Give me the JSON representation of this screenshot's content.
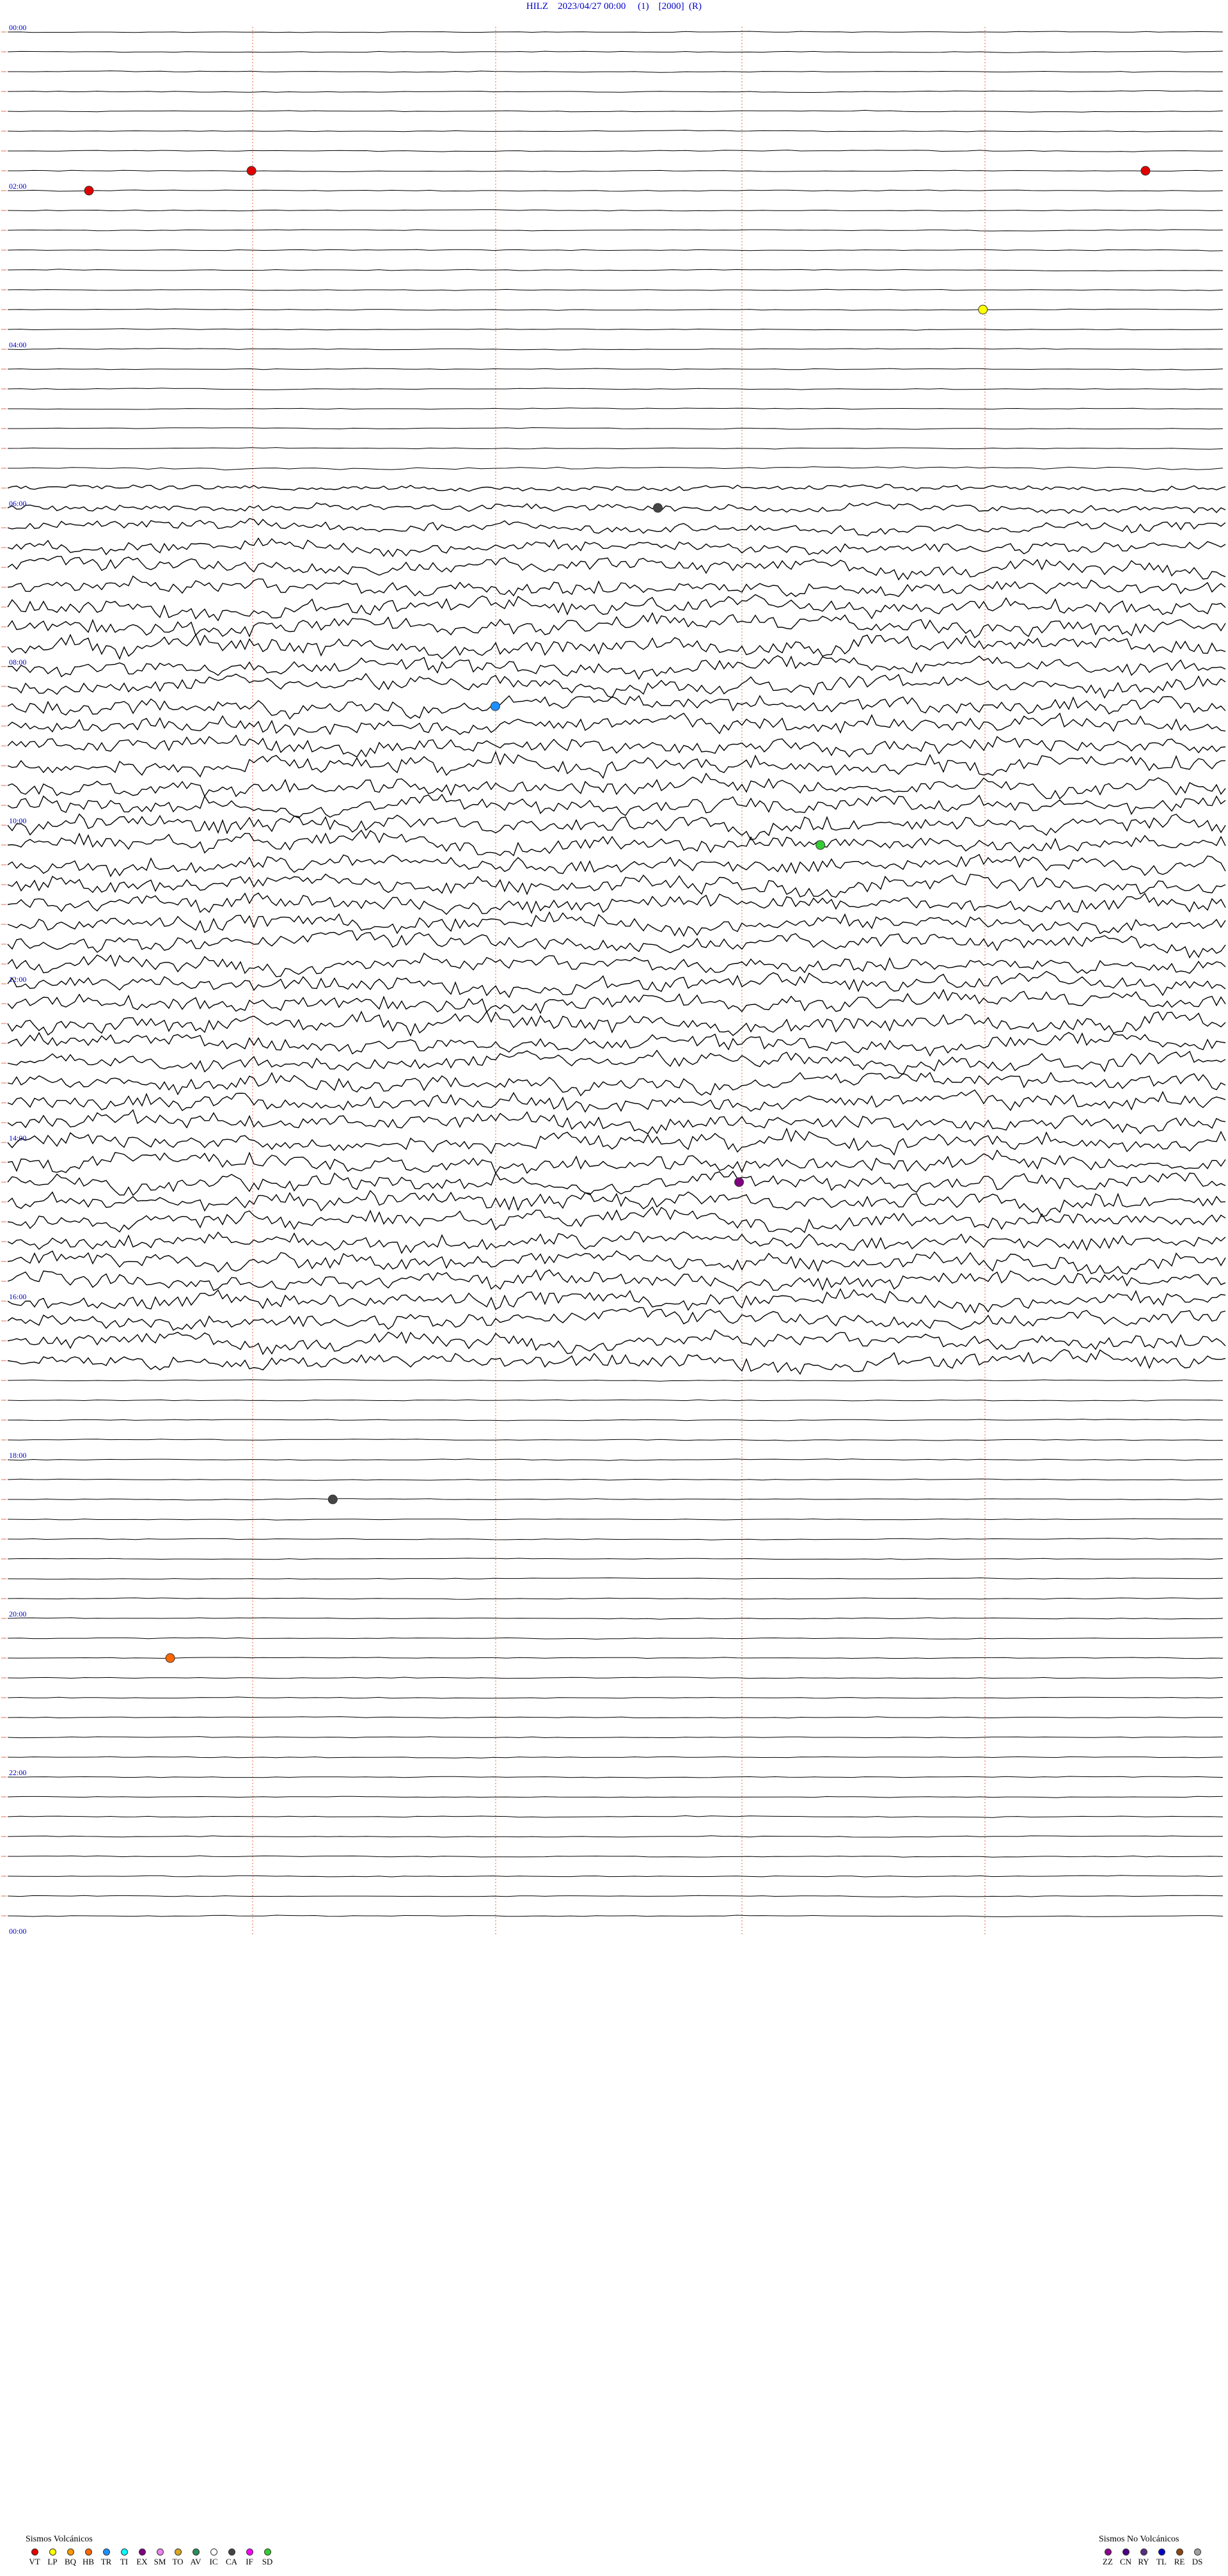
{
  "header": {
    "title": "HILZ    2023/04/27 00:00     (1)    [2000]  (R)"
  },
  "chart_data": {
    "type": "helicorder",
    "station": "HILZ",
    "date": "2023/04/27",
    "start_time": "00:00",
    "hour_labels": [
      "00:00",
      "02:00",
      "04:00",
      "06:00",
      "08:00",
      "10:00",
      "12:00",
      "14:00",
      "16:00",
      "18:00",
      "20:00",
      "22:00",
      "00:00"
    ],
    "rows": 96,
    "minutes_per_row": 15,
    "activity_profile": [
      {
        "from_row": 0,
        "to_row": 21,
        "noise": "low"
      },
      {
        "from_row": 22,
        "to_row": 27,
        "noise": "rising"
      },
      {
        "from_row": 28,
        "to_row": 67,
        "noise": "high"
      },
      {
        "from_row": 68,
        "to_row": 95,
        "noise": "low"
      }
    ],
    "events": [
      {
        "row": 7,
        "minute": 3,
        "type": "VT"
      },
      {
        "row": 7,
        "minute": 14,
        "type": "VT"
      },
      {
        "row": 8,
        "minute": 1,
        "type": "VT"
      },
      {
        "row": 14,
        "minute": 12,
        "type": "LP"
      },
      {
        "row": 24,
        "minute": 8,
        "type": "CA"
      },
      {
        "row": 34,
        "minute": 6,
        "type": "TR"
      },
      {
        "row": 41,
        "minute": 10,
        "type": "SD"
      },
      {
        "row": 58,
        "minute": 9,
        "type": "EX"
      },
      {
        "row": 74,
        "minute": 4,
        "type": "CA"
      },
      {
        "row": 82,
        "minute": 2,
        "type": "HB"
      }
    ],
    "legend": {
      "volcanic_title": "Sismos Volcánicos",
      "volcanic": [
        {
          "code": "VT",
          "color": "#e00000"
        },
        {
          "code": "LP",
          "color": "#ffff00"
        },
        {
          "code": "BQ",
          "color": "#ff9900"
        },
        {
          "code": "HB",
          "color": "#ff6600"
        },
        {
          "code": "TR",
          "color": "#1e90ff"
        },
        {
          "code": "TI",
          "color": "#00ffff"
        },
        {
          "code": "EX",
          "color": "#800080"
        },
        {
          "code": "SM",
          "color": "#ee82ee"
        },
        {
          "code": "TO",
          "color": "#daa520"
        },
        {
          "code": "AV",
          "color": "#2e8b57"
        },
        {
          "code": "IC",
          "color": "#ffffff"
        },
        {
          "code": "CA",
          "color": "#444444"
        },
        {
          "code": "IF",
          "color": "#ff00ff"
        },
        {
          "code": "SD",
          "color": "#32cd32"
        }
      ],
      "nonvolcanic_title": "Sismos No Volcánicos",
      "nonvolcanic": [
        {
          "code": "ZZ",
          "color": "#8b008b"
        },
        {
          "code": "CN",
          "color": "#4b0082"
        },
        {
          "code": "RY",
          "color": "#5a2d82"
        },
        {
          "code": "TL",
          "color": "#0000cd"
        },
        {
          "code": "RE",
          "color": "#8b4513"
        },
        {
          "code": "DS",
          "color": "#a0a0a0"
        }
      ]
    }
  }
}
